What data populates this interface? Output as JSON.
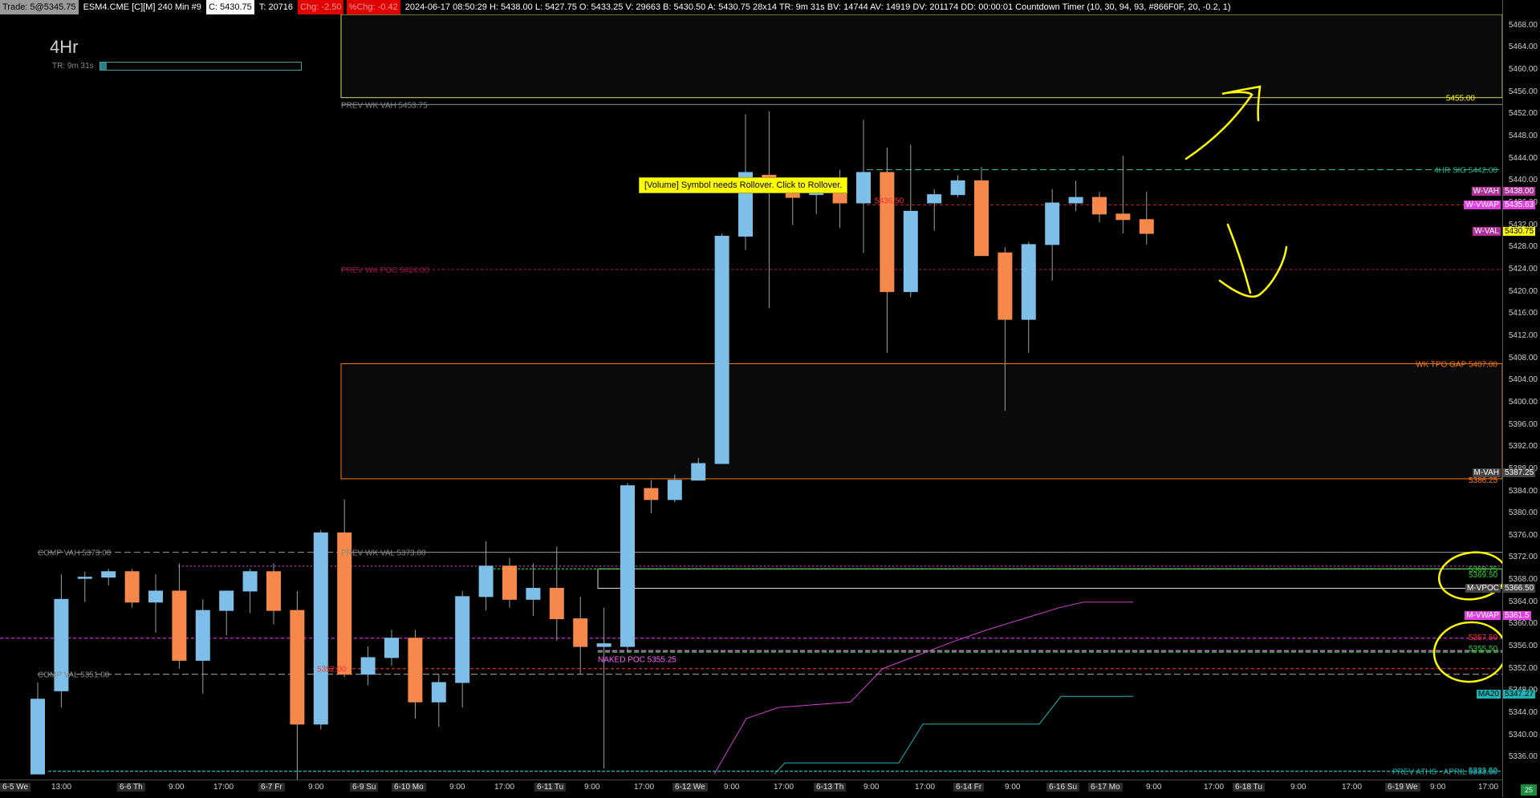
{
  "topbar": {
    "trade": "Trade: 5@5345.75",
    "symbol": "ESM4.CME [C][M]  240 Min  #9",
    "close": "C: 5430.75",
    "ticks": "T: 20716",
    "chg": "Chg: -2.50",
    "pchg": "%Chg: -0.42",
    "stats": "2024-06-17 08:50:29 H: 5438.00  L: 5427.75  O: 5433.25  V: 29663  B: 5430.50  A: 5430.75  28x14  TR: 9m 31s  BV: 14744  AV: 14919  DV: 201174  DD: 00:00:01  Countdown Timer  (10, 30, 94, 93, #866F0F, 20, -0.2, 1)"
  },
  "timeframe": "4Hr",
  "timer": {
    "text": "TR: 9m 31s",
    "fill_fraction": 0.03
  },
  "rollover_message": "[Volume] Symbol needs Rollover. Click to Rollover.",
  "bottom_badge": "25",
  "colors": {
    "up": "#7dbfe8",
    "down": "#f5884a",
    "green": "#2bd12b",
    "magenta": "#ff33ff",
    "teal": "#1fb3b3",
    "yellow": "#ffff00",
    "orange": "#ff7a1a",
    "axis_text": "#cfcfcf"
  },
  "chart_data": {
    "type": "candlestick",
    "title": "4Hr",
    "ylim": [
      5332,
      5470
    ],
    "y_ticks": [
      5468,
      5464,
      5460,
      5456,
      5452,
      5448,
      5444,
      5440,
      5436,
      5432,
      5428,
      5424,
      5420,
      5416,
      5412,
      5408,
      5404,
      5400,
      5396,
      5392,
      5388,
      5384,
      5380,
      5376,
      5372,
      5368,
      5364,
      5360,
      5356,
      5352,
      5348,
      5344,
      5340,
      5336
    ],
    "y_tick_labels": [
      "5468.00",
      "5464.00",
      "5460.00",
      "5456.00",
      "5452.00",
      "5448.00",
      "5444.00",
      "5440.00",
      "5436.00",
      "5432.00",
      "5428.00",
      "5424.00",
      "5420.00",
      "5416.00",
      "5412.00",
      "5408.00",
      "5404.00",
      "5400.00",
      "5396.00",
      "5392.00",
      "5388.00",
      "5384.00",
      "5380.00",
      "5376.00",
      "5372.00",
      "5368.00",
      "5364.00",
      "5360.00",
      "5356.00",
      "5352.00",
      "5348.00",
      "5344.00",
      "5340.00",
      "5336.00"
    ],
    "x_labels": [
      "6-5 We",
      "13:00",
      "6-6 Th",
      "9:00",
      "17:00",
      "6-7 Fr",
      "9:00",
      "6-9 Su",
      "6-10 Mo",
      "9:00",
      "17:00",
      "6-11 Tu",
      "9:00",
      "17:00",
      "6-12 We",
      "9:00",
      "17:00",
      "6-13 Th",
      "9:00",
      "17:00",
      "6-14 Fr",
      "9:00",
      "6-16 Su",
      "6-17 Mo",
      "9:00",
      "17:00",
      "6-18 Tu",
      "9:00",
      "17:00",
      "6-19 We",
      "9:00",
      "17:00"
    ],
    "x_day_markers": [
      "6-5 We",
      "6-6 Th",
      "6-7 Fr",
      "6-9 Su",
      "6-10 Mo",
      "6-11 Tu",
      "6-12 We",
      "6-13 Th",
      "6-14 Fr",
      "6-16 Su",
      "6-17 Mo",
      "6-18 Tu",
      "6-19 We"
    ],
    "candles": [
      {
        "o": 5333.0,
        "h": 5349.5,
        "l": 5333.0,
        "c": 5346.5
      },
      {
        "o": 5348.0,
        "h": 5369.0,
        "l": 5345.0,
        "c": 5364.5
      },
      {
        "o": 5368.5,
        "h": 5369.5,
        "l": 5364.0,
        "c": 5368.5
      },
      {
        "o": 5368.5,
        "h": 5370.0,
        "l": 5367.0,
        "c": 5369.5
      },
      {
        "o": 5369.5,
        "h": 5370.0,
        "l": 5363.0,
        "c": 5364.0
      },
      {
        "o": 5364.0,
        "h": 5369.0,
        "l": 5358.5,
        "c": 5366.0
      },
      {
        "o": 5366.0,
        "h": 5371.0,
        "l": 5352.0,
        "c": 5353.5
      },
      {
        "o": 5353.5,
        "h": 5364.5,
        "l": 5347.5,
        "c": 5362.5
      },
      {
        "o": 5362.5,
        "h": 5366.0,
        "l": 5358.0,
        "c": 5366.0
      },
      {
        "o": 5366.0,
        "h": 5370.0,
        "l": 5362.0,
        "c": 5369.5
      },
      {
        "o": 5369.5,
        "h": 5371.0,
        "l": 5360.0,
        "c": 5362.5
      },
      {
        "o": 5362.5,
        "h": 5366.0,
        "l": 5331.0,
        "c": 5342.0
      },
      {
        "o": 5342.0,
        "h": 5377.0,
        "l": 5341.0,
        "c": 5376.5
      },
      {
        "o": 5376.5,
        "h": 5382.5,
        "l": 5350.5,
        "c": 5351.0
      },
      {
        "o": 5351.0,
        "h": 5356.0,
        "l": 5349.0,
        "c": 5354.0
      },
      {
        "o": 5354.0,
        "h": 5359.0,
        "l": 5352.5,
        "c": 5357.5
      },
      {
        "o": 5357.5,
        "h": 5359.0,
        "l": 5343.0,
        "c": 5346.0
      },
      {
        "o": 5346.0,
        "h": 5351.0,
        "l": 5341.5,
        "c": 5349.5
      },
      {
        "o": 5349.5,
        "h": 5366.0,
        "l": 5345.0,
        "c": 5365.0
      },
      {
        "o": 5365.0,
        "h": 5375.0,
        "l": 5362.5,
        "c": 5370.5
      },
      {
        "o": 5370.5,
        "h": 5372.0,
        "l": 5363.0,
        "c": 5364.5
      },
      {
        "o": 5364.5,
        "h": 5371.0,
        "l": 5361.5,
        "c": 5366.5
      },
      {
        "o": 5366.5,
        "h": 5374.0,
        "l": 5357.0,
        "c": 5361.0
      },
      {
        "o": 5361.0,
        "h": 5365.0,
        "l": 5351.0,
        "c": 5356.0
      },
      {
        "o": 5356.0,
        "h": 5363.0,
        "l": 5334.0,
        "c": 5356.5
      },
      {
        "o": 5356.0,
        "h": 5385.5,
        "l": 5355.0,
        "c": 5385.0
      },
      {
        "o": 5384.5,
        "h": 5386.0,
        "l": 5380.0,
        "c": 5382.5
      },
      {
        "o": 5382.5,
        "h": 5387.0,
        "l": 5382.0,
        "c": 5386.0
      },
      {
        "o": 5386.0,
        "h": 5390.0,
        "l": 5386.0,
        "c": 5389.0
      },
      {
        "o": 5389.0,
        "h": 5430.5,
        "l": 5389.0,
        "c": 5430.0
      },
      {
        "o": 5430.0,
        "h": 5452.0,
        "l": 5427.5,
        "c": 5441.5
      },
      {
        "o": 5441.0,
        "h": 5452.5,
        "l": 5417.0,
        "c": 5440.5
      },
      {
        "o": 5438.5,
        "h": 5439.0,
        "l": 5432.0,
        "c": 5437.0
      },
      {
        "o": 5437.5,
        "h": 5440.0,
        "l": 5434.0,
        "c": 5438.0
      },
      {
        "o": 5438.5,
        "h": 5442.0,
        "l": 5431.5,
        "c": 5436.0
      },
      {
        "o": 5436.0,
        "h": 5451.0,
        "l": 5427.0,
        "c": 5441.5
      },
      {
        "o": 5441.5,
        "h": 5446.0,
        "l": 5409.0,
        "c": 5420.0
      },
      {
        "o": 5420.0,
        "h": 5446.5,
        "l": 5419.0,
        "c": 5434.5
      },
      {
        "o": 5436.0,
        "h": 5438.5,
        "l": 5431.0,
        "c": 5437.5
      },
      {
        "o": 5437.5,
        "h": 5441.0,
        "l": 5437.0,
        "c": 5440.0
      },
      {
        "o": 5440.0,
        "h": 5442.5,
        "l": 5426.5,
        "c": 5426.5
      },
      {
        "o": 5427.0,
        "h": 5428.0,
        "l": 5398.5,
        "c": 5415.0
      },
      {
        "o": 5415.0,
        "h": 5429.0,
        "l": 5409.0,
        "c": 5428.5
      },
      {
        "o": 5428.5,
        "h": 5438.5,
        "l": 5422.0,
        "c": 5436.0
      },
      {
        "o": 5436.0,
        "h": 5440.0,
        "l": 5434.5,
        "c": 5437.0
      },
      {
        "o": 5437.0,
        "h": 5438.0,
        "l": 5432.5,
        "c": 5434.0
      },
      {
        "o": 5434.0,
        "h": 5444.5,
        "l": 5430.5,
        "c": 5433.0
      },
      {
        "o": 5433.0,
        "h": 5438.0,
        "l": 5428.5,
        "c": 5430.5
      }
    ],
    "levels": [
      {
        "name": "PREV WK VAH",
        "value": 5453.75,
        "label": "PREV WK VAH  5453.75",
        "color": "#888888"
      },
      {
        "name": "4HR SIG",
        "value": 5442.0,
        "label": "4HR SIG   5442.00",
        "color": "#2db38b"
      },
      {
        "name": "PREV WK POC",
        "value": 5424.0,
        "label": "PREV WK POC  5424.00",
        "color": "#a01050"
      },
      {
        "name": "WK TPO GAP",
        "value": 5407.0,
        "label": "WK TPO GAP  5407.00",
        "color": "#ff7a1a"
      },
      {
        "name": "COMP VAH",
        "value": 5373.0,
        "label": "COMP VAH  5373.00",
        "color": "#888888"
      },
      {
        "name": "PREV WK VAL",
        "value": 5373.0,
        "label": "PREV WK VAL  5373.00",
        "color": "#888888"
      },
      {
        "name": "COMP VAL",
        "value": 5351.0,
        "label": "COMP VAL  5351.00",
        "color": "#888888"
      },
      {
        "name": "NAKED POC",
        "value": 5355.25,
        "label": "NAKED POC  5355.25",
        "color": "#ff66ff"
      },
      {
        "name": "PREV ATHS - APRIL",
        "value": 5333.5,
        "label": "PREV ATHS - APRIL  5333.50",
        "color": "#1fb3b3"
      }
    ],
    "price_tags": [
      {
        "label": "W-VAH",
        "value": "5438.00",
        "y": 5438.0,
        "bg": "#b0309a",
        "fg": "#ffffff"
      },
      {
        "label": "W-VWAP",
        "value": "5435.63",
        "y": 5435.63,
        "bg": "#e040e0",
        "fg": "#ffffff"
      },
      {
        "label": "W-VAL",
        "value": "5430.75",
        "y": 5430.75,
        "bg": "#b0309a",
        "fg": "#ffffff",
        "value_bg": "#ffff00",
        "value_fg": "#000000"
      },
      {
        "label": "M-VAH",
        "value": "5387.25",
        "y": 5387.25,
        "bg": "#444444",
        "fg": "#ffffff"
      },
      {
        "label": "",
        "value": "5386.25",
        "y": 5385.75,
        "bg": "",
        "fg": "#ff7a1a"
      },
      {
        "label": "",
        "value": "5369.75",
        "y": 5369.75,
        "bg": "",
        "fg": "#2bd12b"
      },
      {
        "label": "",
        "value": "5369.50",
        "y": 5368.75,
        "bg": "",
        "fg": "#2bd12b"
      },
      {
        "label": "M-VPOC",
        "value": "5366.50",
        "y": 5366.5,
        "bg": "#444444",
        "fg": "#ffffff"
      },
      {
        "label": "M-VWAP",
        "value": "5361.5",
        "y": 5361.5,
        "bg": "#e040e0",
        "fg": "#ffffff"
      },
      {
        "label": "",
        "value": "5357.50",
        "y": 5357.5,
        "bg": "",
        "fg": "#ff3333"
      },
      {
        "label": "",
        "value": "5355.50",
        "y": 5355.5,
        "bg": "",
        "fg": "#2bd12b"
      },
      {
        "label": "MA20",
        "value": "5347.27",
        "y": 5347.27,
        "bg": "#1fb3b3",
        "fg": "#000000"
      },
      {
        "label": "",
        "value": "5333.50",
        "y": 5333.5,
        "bg": "",
        "fg": "#1fb3b3"
      }
    ],
    "zones": [
      {
        "name": "upper-box",
        "top": 5470,
        "bottom": 5455.0,
        "label": "5455.00",
        "color": "#d8d870"
      },
      {
        "name": "tpo-gap-box",
        "top": 5407.0,
        "bottom": 5386.25,
        "label": "",
        "color": "#ff7a1a"
      }
    ],
    "inline_labels": [
      {
        "text": "5436.50",
        "y": 5436.5,
        "color": "#ff3333"
      },
      {
        "text": "5352.00",
        "y": 5352.0,
        "color": "#ff3333"
      }
    ]
  }
}
